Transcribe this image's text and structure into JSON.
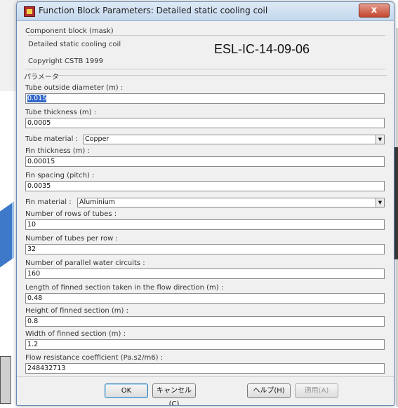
{
  "window": {
    "title": "Function Block Parameters: Detailed static cooling coil",
    "close_glyph": "x"
  },
  "mask": {
    "group_label": "Component block (mask)",
    "description": "Detailed static cooling coil",
    "copyright": "Copyright CSTB 1999"
  },
  "overlay_text": "ESL-IC-14-09-06",
  "params_label": "パラメータ",
  "fields": [
    {
      "label": "Tube outside diameter (m) :",
      "value": "0.015",
      "selected": true
    },
    {
      "label": "Tube thickness (m) :",
      "value": "0.0005"
    },
    {
      "label": "Fin thickness (m) :",
      "value": "0.00015"
    },
    {
      "label": "Fin spacing (pitch) :",
      "value": "0.0035"
    },
    {
      "label": "Number of rows of tubes :",
      "value": "10"
    },
    {
      "label": "Number of tubes per row :",
      "value": "32"
    },
    {
      "label": "Number of parallel water circuits :",
      "value": "160"
    },
    {
      "label": "Length of finned section taken in the flow direction  (m) :",
      "value": "0.48"
    },
    {
      "label": " Height of finned section (m) :",
      "value": "0.8"
    },
    {
      "label": " Width of finned section (m) :",
      "value": "1.2"
    },
    {
      "label": "Flow resistance coefficient (Pa.s2/m6) :",
      "value": "248432713"
    }
  ],
  "selects": [
    {
      "label": "Tube material :",
      "value": "Copper"
    },
    {
      "label": "Fin material :",
      "value": "Aluminium"
    }
  ],
  "buttons": {
    "ok": "OK",
    "cancel": "キャンセル(C)",
    "help": "ヘルプ(H)",
    "apply": "適用(A)"
  }
}
